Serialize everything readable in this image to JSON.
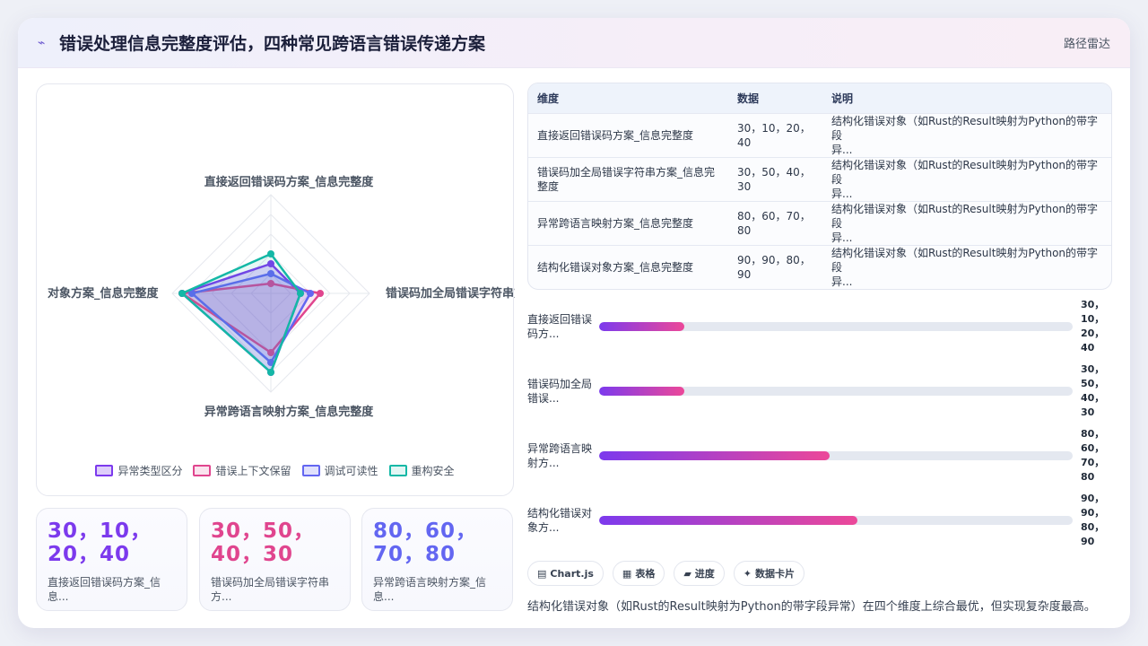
{
  "header": {
    "title": "错误处理信息完整度评估，四种常见跨语言错误传递方案",
    "tag": "路径雷达"
  },
  "legend": [
    {
      "label": "异常类型区分",
      "color": "#7c3aed"
    },
    {
      "label": "错误上下文保留",
      "color": "#e0458e"
    },
    {
      "label": "调试可读性",
      "color": "#6366f1"
    },
    {
      "label": "重构安全",
      "color": "#14b8a6"
    }
  ],
  "chart_data": {
    "type": "radar",
    "categories": [
      "直接返回错误码方案_信息完整度",
      "错误码加全局错误字符串方案_信息完整度",
      "异常跨语言映射方案_信息完整度",
      "结构化错误对象方案_信息完整度"
    ],
    "axis_labels": [
      "直接返回错误码方案_信息完整度",
      "错误码加全局错误字符串方案_",
      "异常跨语言映射方案_信息完整度",
      "对象方案_信息完整度"
    ],
    "ylim": [
      0,
      100
    ],
    "series": [
      {
        "name": "异常类型区分",
        "values": [
          30,
          30,
          80,
          90
        ],
        "color": "#7c3aed"
      },
      {
        "name": "错误上下文保留",
        "values": [
          10,
          50,
          60,
          90
        ],
        "color": "#e0458e"
      },
      {
        "name": "调试可读性",
        "values": [
          20,
          40,
          70,
          80
        ],
        "color": "#6366f1"
      },
      {
        "name": "重构安全",
        "values": [
          40,
          30,
          80,
          90
        ],
        "color": "#14b8a6"
      }
    ]
  },
  "stats": [
    {
      "value_line1": "30，10，",
      "value_line2": "20，40",
      "label_line1": "直接返回错误码方案_信",
      "label_line2": "息...",
      "color": "#7c3aed"
    },
    {
      "value_line1": "30，50，",
      "value_line2": "40，30",
      "label_line1": "错误码加全局错误字符串",
      "label_line2": "方...",
      "color": "#e0458e"
    },
    {
      "value_line1": "80，60，",
      "value_line2": "70，80",
      "label_line1": "异常跨语言映射方案_信",
      "label_line2": "息...",
      "color": "#6366f1"
    }
  ],
  "table": {
    "headers": [
      "维度",
      "数据",
      "说明"
    ],
    "rows": [
      {
        "name_line1": "直接返回错误码方案_信息完整度",
        "name_line2": "",
        "val_line1": "30，10，20，",
        "val_line2": "40",
        "desc_line1": "结构化错误对象（如Rust的Result映射为Python的带字段",
        "desc_line2": "异..."
      },
      {
        "name_line1": "错误码加全局错误字符串方案_信息完",
        "name_line2": "整度",
        "val_line1": "30，50，40，",
        "val_line2": "30",
        "desc_line1": "结构化错误对象（如Rust的Result映射为Python的带字段",
        "desc_line2": "异..."
      },
      {
        "name_line1": "异常跨语言映射方案_信息完整度",
        "name_line2": "",
        "val_line1": "80，60，70，",
        "val_line2": "80",
        "desc_line1": "结构化错误对象（如Rust的Result映射为Python的带字段",
        "desc_line2": "异..."
      },
      {
        "name_line1": "结构化错误对象方案_信息完整度",
        "name_line2": "",
        "val_line1": "90，90，80，",
        "val_line2": "90",
        "desc_line1": "结构化错误对象（如Rust的Result映射为Python的带字段",
        "desc_line2": "异..."
      }
    ]
  },
  "progress": [
    {
      "label_line1": "直接返回错误",
      "label_line2": "码方...",
      "value_lines": [
        "30，",
        "10，",
        "20，",
        "40"
      ],
      "fraction": 0.18
    },
    {
      "label_line1": "错误码加全局",
      "label_line2": "错误...",
      "value_lines": [
        "30，",
        "50，",
        "40，",
        "30"
      ],
      "fraction": 0.18
    },
    {
      "label_line1": "异常跨语言映",
      "label_line2": "射方...",
      "value_lines": [
        "80，",
        "60，",
        "70，",
        "80"
      ],
      "fraction": 0.487
    },
    {
      "label_line1": "结构化错误对",
      "label_line2": "象方...",
      "value_lines": [
        "90，",
        "90，",
        "80，",
        "90"
      ],
      "fraction": 0.546
    }
  ],
  "chips": [
    {
      "icon": "▤",
      "label": "Chart.js"
    },
    {
      "icon": "▦",
      "label": "表格"
    },
    {
      "icon": "▰",
      "label": "进度"
    },
    {
      "icon": "✦",
      "label": "数据卡片"
    }
  ],
  "summary": "结构化错误对象（如Rust的Result映射为Python的带字段异常）在四个维度上综合最优，但实现复杂度最高。"
}
